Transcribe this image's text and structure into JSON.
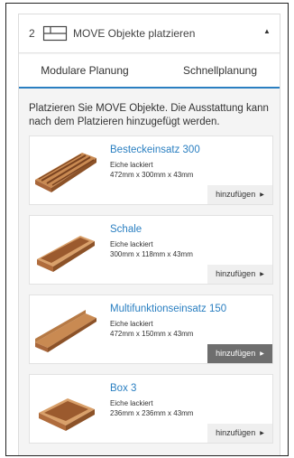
{
  "section": {
    "step": "2",
    "icon": "module-tray-icon",
    "title": "MOVE Objekte platzieren",
    "toggle_icon": "caret-up-icon"
  },
  "tabs": [
    {
      "label": "Modulare Planung",
      "active": true
    },
    {
      "label": "Schnellplanung",
      "active": false
    }
  ],
  "intro": "Platzieren Sie MOVE Objekte. Die Ausstattung kann nach dem Platzieren hinzugefügt werden.",
  "items": [
    {
      "name": "Besteckeinsatz 300",
      "finish": "Eiche lackiert",
      "dims": "472mm x 300mm x 43mm",
      "button": "hinzufügen",
      "button_icon": "caret-right-icon",
      "image": "cutlery-tray"
    },
    {
      "name": "Schale",
      "finish": "Eiche lackiert",
      "dims": "300mm x 118mm x 43mm",
      "button": "hinzufügen",
      "button_icon": "caret-right-icon",
      "image": "small-tray"
    },
    {
      "name": "Multifunktionseinsatz 150",
      "finish": "Eiche lackiert",
      "dims": "472mm x 150mm x 43mm",
      "button": "hinzufügen",
      "button_icon": "caret-right-icon",
      "image": "multi-insert",
      "hovered": true
    },
    {
      "name": "Box 3",
      "finish": "Eiche lackiert",
      "dims": "236mm x 236mm x 43mm",
      "button": "hinzufügen",
      "button_icon": "caret-right-icon",
      "image": "square-box"
    }
  ],
  "colors": {
    "accent": "#2a7fc1",
    "wood": "#b8703c",
    "button_bg": "#efefef",
    "button_hover": "#6e6e6e"
  }
}
